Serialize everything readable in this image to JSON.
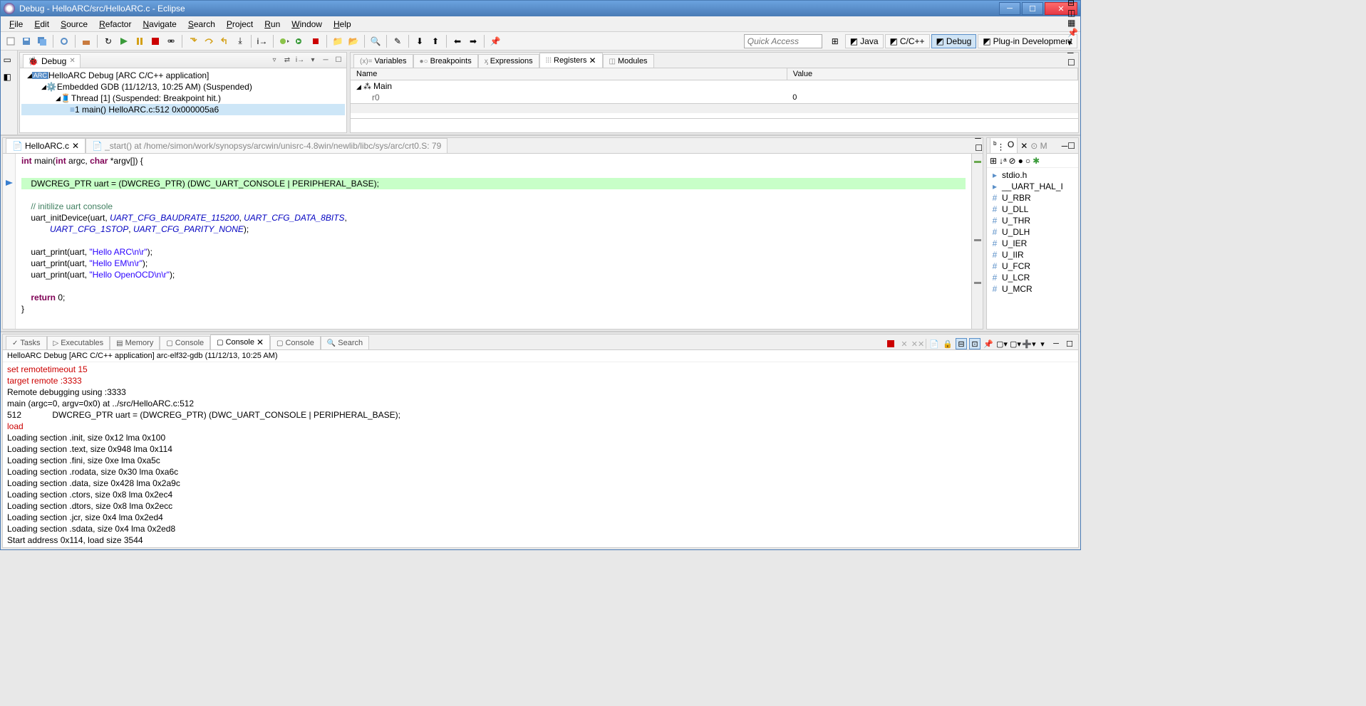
{
  "window_title": "Debug - HelloARC/src/HelloARC.c - Eclipse",
  "menu": [
    "File",
    "Edit",
    "Source",
    "Refactor",
    "Navigate",
    "Search",
    "Project",
    "Run",
    "Window",
    "Help"
  ],
  "quick_access_placeholder": "Quick Access",
  "perspectives": [
    {
      "label": "Java"
    },
    {
      "label": "C/C++"
    },
    {
      "label": "Debug",
      "active": true
    },
    {
      "label": "Plug-in Development"
    }
  ],
  "debug_view_title": "Debug",
  "debug_tree": [
    {
      "level": 0,
      "label": "HelloARC Debug [ARC C/C++ application]",
      "icon": "app"
    },
    {
      "level": 1,
      "label": "Embedded GDB (11/12/13, 10:25 AM) (Suspended)",
      "icon": "gdb"
    },
    {
      "level": 2,
      "label": "Thread [1] (Suspended: Breakpoint hit.)",
      "icon": "thread"
    },
    {
      "level": 3,
      "label": "1 main() HelloARC.c:512 0x000005a6",
      "icon": "frame",
      "selected": true
    }
  ],
  "var_tabs": [
    "Variables",
    "Breakpoints",
    "Expressions",
    "Registers",
    "Modules"
  ],
  "var_active_tab": "Registers",
  "var_columns": [
    "Name",
    "Value"
  ],
  "var_rows": [
    {
      "name": "Main",
      "value": "",
      "expandable": true
    },
    {
      "name": "r0",
      "value": "0",
      "child": true
    }
  ],
  "editor_tabs": [
    {
      "label": "HelloARC.c",
      "active": true
    },
    {
      "label": "_start()  at /home/simon/work/synopsys/arcwin/unisrc-4.8win/newlib/libc/sys/arc/crt0.S: 79",
      "greyed": true
    }
  ],
  "outline_tabs": [
    "O",
    "M"
  ],
  "outline_items": [
    {
      "icon": "inc",
      "label": "stdio.h"
    },
    {
      "icon": "inc",
      "label": "__UART_HAL_I"
    },
    {
      "icon": "def",
      "label": "U_RBR"
    },
    {
      "icon": "def",
      "label": "U_DLL"
    },
    {
      "icon": "def",
      "label": "U_THR"
    },
    {
      "icon": "def",
      "label": "U_DLH"
    },
    {
      "icon": "def",
      "label": "U_IER"
    },
    {
      "icon": "def",
      "label": "U_IIR"
    },
    {
      "icon": "def",
      "label": "U_FCR"
    },
    {
      "icon": "def",
      "label": "U_LCR"
    },
    {
      "icon": "def",
      "label": "U_MCR"
    }
  ],
  "console_tabs": [
    "Tasks",
    "Executables",
    "Memory",
    "Console",
    "Console",
    "Console",
    "Search"
  ],
  "console_active_index": 4,
  "console_label": "HelloARC Debug [ARC C/C++ application] arc-elf32-gdb (11/12/13, 10:25 AM)",
  "console_lines": [
    {
      "cls": "red",
      "text": "set remotetimeout 15"
    },
    {
      "cls": "red",
      "text": "target remote :3333"
    },
    {
      "cls": "",
      "text": "Remote debugging using :3333"
    },
    {
      "cls": "",
      "text": "main (argc=0, argv=0x0) at ../src/HelloARC.c:512"
    },
    {
      "cls": "",
      "text": "512             DWCREG_PTR uart = (DWCREG_PTR) (DWC_UART_CONSOLE | PERIPHERAL_BASE);"
    },
    {
      "cls": "red",
      "text": "load"
    },
    {
      "cls": "",
      "text": "Loading section .init, size 0x12 lma 0x100"
    },
    {
      "cls": "",
      "text": "Loading section .text, size 0x948 lma 0x114"
    },
    {
      "cls": "",
      "text": "Loading section .fini, size 0xe lma 0xa5c"
    },
    {
      "cls": "",
      "text": "Loading section .rodata, size 0x30 lma 0xa6c"
    },
    {
      "cls": "",
      "text": "Loading section .data, size 0x428 lma 0x2a9c"
    },
    {
      "cls": "",
      "text": "Loading section .ctors, size 0x8 lma 0x2ec4"
    },
    {
      "cls": "",
      "text": "Loading section .dtors, size 0x8 lma 0x2ecc"
    },
    {
      "cls": "",
      "text": "Loading section .jcr, size 0x4 lma 0x2ed4"
    },
    {
      "cls": "",
      "text": "Loading section .sdata, size 0x4 lma 0x2ed8"
    },
    {
      "cls": "",
      "text": "Start address 0x114, load size 3544"
    }
  ],
  "code": {
    "sig_kw1": "int",
    "sig_name": "main(",
    "sig_kw2": "int",
    "sig_p": " argc, ",
    "sig_kw3": "char",
    "sig_rest": " *argv[]) {",
    "hl_line": "    DWCREG_PTR uart = (DWCREG_PTR) (DWC_UART_CONSOLE | PERIPHERAL_BASE);",
    "comment": "    // initilize uart console",
    "l4a": "    uart_initDevice(uart, ",
    "c1": "UART_CFG_BAUDRATE_115200",
    "l4b": ", ",
    "c2": "UART_CFG_DATA_8BITS",
    "l4c": ",",
    "l5a": "            ",
    "c3": "UART_CFG_1STOP",
    "l5b": ", ",
    "c4": "UART_CFG_PARITY_NONE",
    "l5c": ");",
    "p1a": "    uart_print(uart, ",
    "s1": "\"Hello ARC\\n\\r\"",
    "p1b": ");",
    "p2a": "    uart_print(uart, ",
    "s2": "\"Hello EM\\n\\r\"",
    "p2b": ");",
    "p3a": "    uart_print(uart, ",
    "s3": "\"Hello OpenOCD\\n\\r\"",
    "p3b": ");",
    "ret_kw": "return",
    "ret_rest": " 0;",
    "brace": "}"
  }
}
